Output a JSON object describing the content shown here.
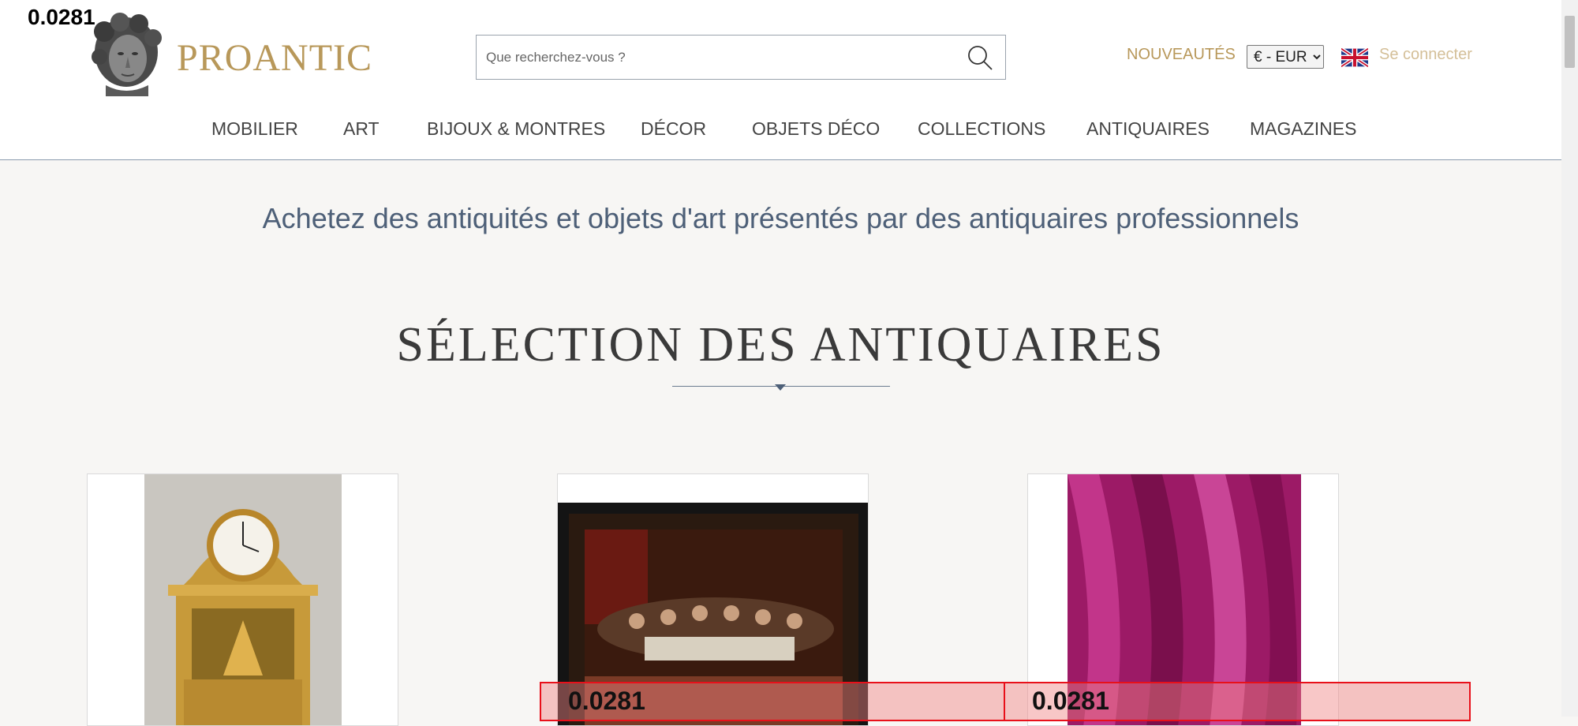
{
  "debug": {
    "top_left_label": "0.0281"
  },
  "header": {
    "brand": "PROANTIC",
    "search": {
      "placeholder": "Que recherchez-vous ?",
      "value": ""
    },
    "nouveautes": "NOUVEAUTÉS",
    "currency": {
      "selected": "€ - EUR"
    },
    "flag_icon": "uk-flag-icon",
    "login": "Se connecter"
  },
  "nav": {
    "items": [
      {
        "label": "MOBILIER"
      },
      {
        "label": "ART"
      },
      {
        "label": "BIJOUX & MONTRES"
      },
      {
        "label": "DÉCOR"
      },
      {
        "label": "OBJETS DÉCO"
      },
      {
        "label": "COLLECTIONS"
      },
      {
        "label": "ANTIQUAIRES"
      },
      {
        "label": "MAGAZINES"
      }
    ]
  },
  "main": {
    "tagline": "Achetez des antiquités et objets d'art présentés par des antiquaires professionnels",
    "section_title": "SÉLECTION DES ANTIQUAIRES"
  },
  "overlays": [
    {
      "label": "0.0281"
    },
    {
      "label": "0.0281"
    }
  ],
  "colors": {
    "brand_gold": "#b8985a",
    "nav_text": "#444444",
    "tagline": "#4e6078"
  }
}
